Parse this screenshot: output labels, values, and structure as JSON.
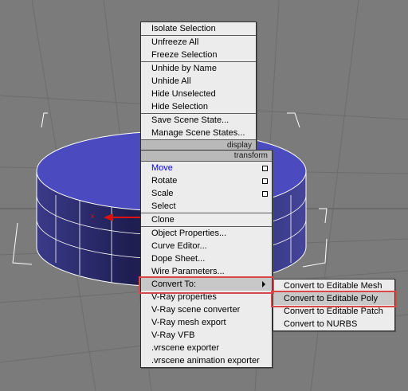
{
  "menu_top": {
    "items": [
      "Isolate Selection",
      "Unfreeze All",
      "Freeze Selection",
      "Unhide by Name",
      "Unhide All",
      "Hide Unselected",
      "Hide Selection",
      "Save Scene State...",
      "Manage Scene States..."
    ],
    "section_label": "display"
  },
  "menu_bottom": {
    "section_label": "transform",
    "items": [
      "Move",
      "Rotate",
      "Scale",
      "Select",
      "Clone",
      "Object Properties...",
      "Curve Editor...",
      "Dope Sheet...",
      "Wire Parameters...",
      "Convert To:",
      "V-Ray properties",
      "V-Ray scene converter",
      "V-Ray mesh export",
      "V-Ray VFB",
      ".vrscene exporter",
      ".vrscene animation exporter"
    ]
  },
  "submenu": {
    "items": [
      "Convert to Editable Mesh",
      "Convert to Editable Poly",
      "Convert to Editable Patch",
      "Convert to NURBS"
    ]
  },
  "viewport": {
    "axis_label": "x",
    "colors": {
      "background": "#7b7b7b",
      "cylinder_top": "#4b4bbf",
      "cylinder_side": "#2a2a70",
      "highlight": "#d94848",
      "menu_bg": "#ececec",
      "menu_header": "#b9b9b9",
      "active_item": "#0000ff"
    }
  }
}
